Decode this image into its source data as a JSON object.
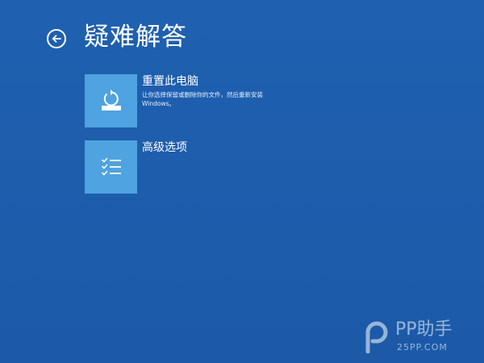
{
  "page": {
    "title": "疑难解答",
    "back_icon": "back-arrow-circle-icon"
  },
  "options": [
    {
      "title": "重置此电脑",
      "description": "让你选择保留或删除你的文件，然后重新安装 Windows。",
      "icon": "reset-pc-icon"
    },
    {
      "title": "高级选项",
      "description": "",
      "icon": "checklist-icon"
    }
  ],
  "watermark": {
    "brand": "PP助手",
    "site": "25PP.COM",
    "icon": "pp-logo-icon"
  },
  "colors": {
    "background": "#1e5eae",
    "tile": "#4fa3e0",
    "text": "#ffffff"
  }
}
